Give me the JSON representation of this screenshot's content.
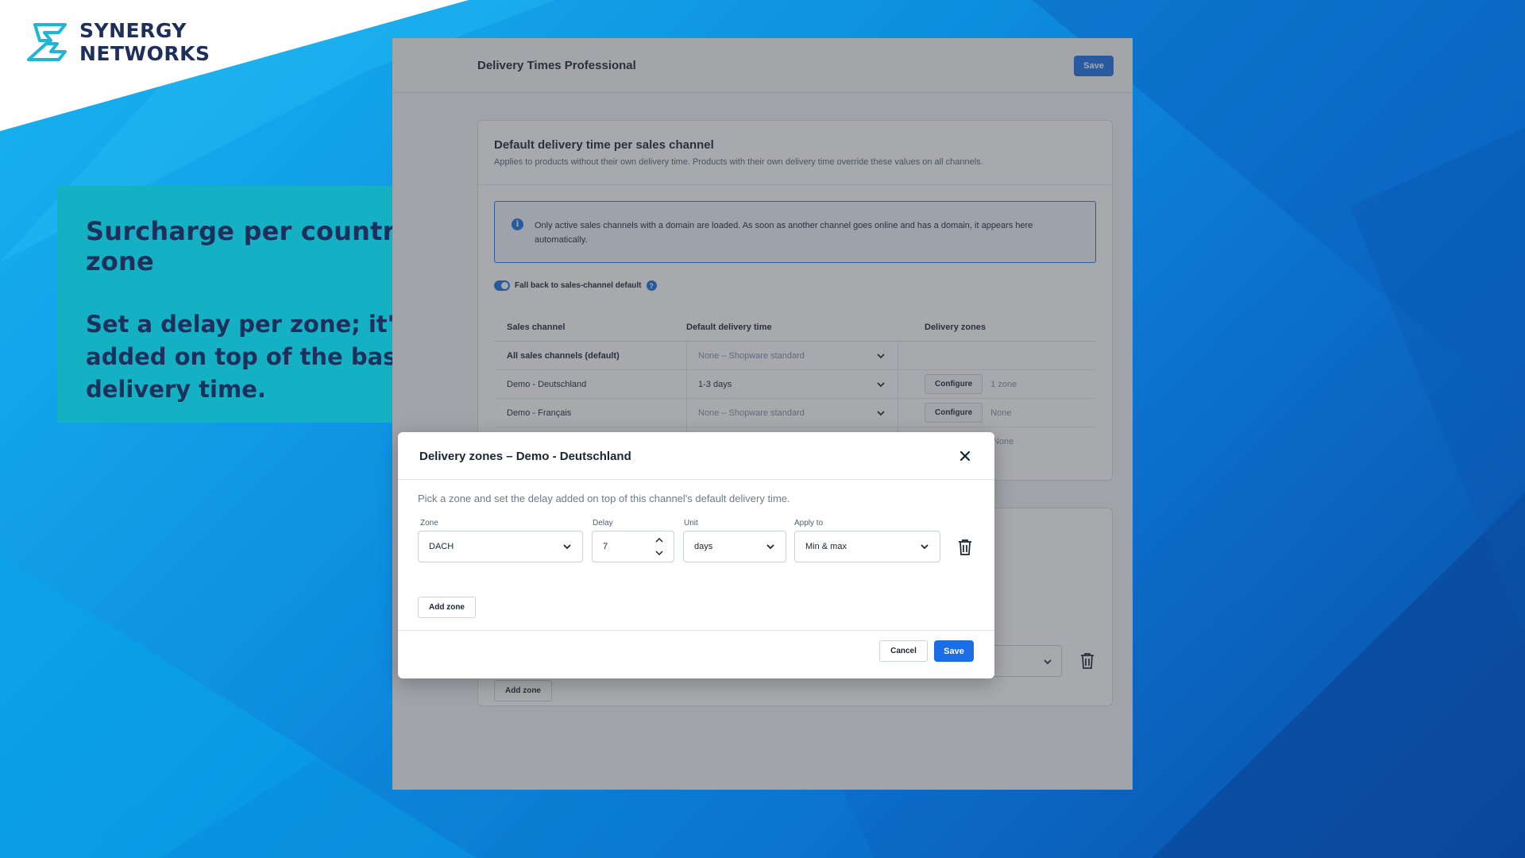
{
  "brand": {
    "line1": "SYNERGY",
    "line2": "NETWORKS",
    "icon": "synergy-logo-mark"
  },
  "promo": {
    "title": "Surcharge per country zone",
    "body": "Set a delay per zone; it's added on top of the base delivery time."
  },
  "admin": {
    "title": "Delivery Times Professional",
    "save_label": "Save",
    "card": {
      "title": "Default delivery time per sales channel",
      "subtitle": "Applies to products without their own delivery time. Products with their own delivery time override these values on all channels.",
      "notice": "Only active sales channels with a domain are loaded. As soon as another channel goes online and has a domain, it appears here automatically.",
      "fallback_label": "Fall back to sales-channel default",
      "fallback_enabled": true,
      "columns": [
        "Sales channel",
        "Default delivery time",
        "Delivery zones"
      ],
      "rows": [
        {
          "channel": "All sales channels (default)",
          "time": "None – Shopware standard",
          "configure": "",
          "zones": ""
        },
        {
          "channel": "Demo - Deutschland",
          "time": "1-3 days",
          "configure": "Configure",
          "zones": "1 zone"
        },
        {
          "channel": "Demo - Français",
          "time": "None – Shopware standard",
          "configure": "Configure",
          "zones": "None"
        },
        {
          "channel": "",
          "time": "",
          "configure": "",
          "zones": "None"
        }
      ]
    },
    "card2": {
      "add_zone_label": "Add zone"
    }
  },
  "modal": {
    "title": "Delivery zones – Demo - Deutschland",
    "description": "Pick a zone and set the delay added on top of this channel's default delivery time.",
    "fields": {
      "zone_label": "Zone",
      "zone_value": "DACH",
      "delay_label": "Delay",
      "delay_value": "7",
      "unit_label": "Unit",
      "unit_value": "days",
      "apply_label": "Apply to",
      "apply_value": "Min & max"
    },
    "add_zone_label": "Add zone",
    "cancel_label": "Cancel",
    "save_label": "Save"
  },
  "colors": {
    "accent": "#1a6de5",
    "teal_panel": "#14b1c4",
    "brand_navy": "#1e2f5c"
  }
}
